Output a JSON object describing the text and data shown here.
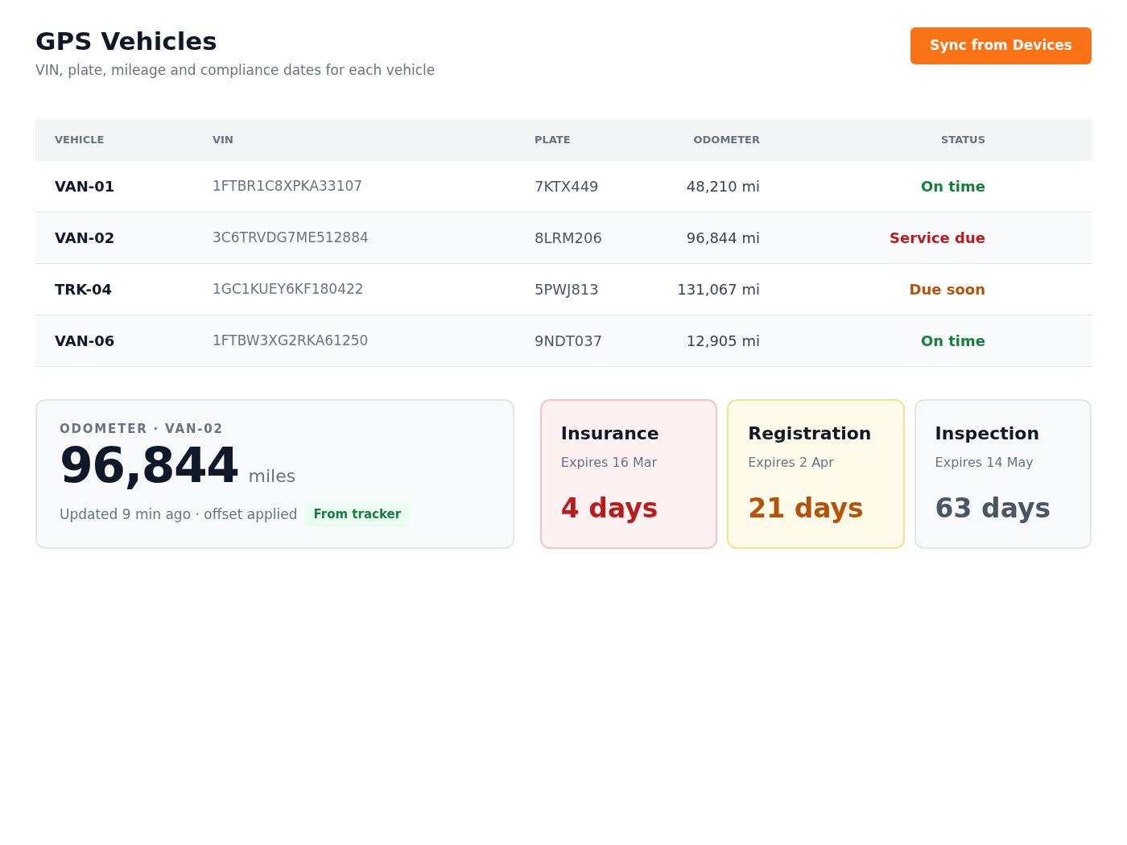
{
  "header": {
    "title": "GPS Vehicles",
    "subtitle": "VIN, plate, mileage and compliance dates for each vehicle",
    "action": "Sync from Devices"
  },
  "table": {
    "columns": [
      "VEHICLE",
      "VIN",
      "PLATE",
      "ODOMETER",
      "STATUS"
    ],
    "rows": [
      {
        "vehicle": "VAN-01",
        "vin": "1FTBR1C8XPKA33107",
        "plate": "7KTX449",
        "odometer": "48,210 mi",
        "status": "On time",
        "kind": "ok"
      },
      {
        "vehicle": "VAN-02",
        "vin": "3C6TRVDG7ME512884",
        "plate": "8LRM206",
        "odometer": "96,844 mi",
        "status": "Service due",
        "kind": "due"
      },
      {
        "vehicle": "TRK-04",
        "vin": "1GC1KUEY6KF180422",
        "plate": "5PWJ813",
        "odometer": "131,067 mi",
        "status": "Due soon",
        "kind": "soon"
      },
      {
        "vehicle": "VAN-06",
        "vin": "1FTBW3XG2RKA61250",
        "plate": "9NDT037",
        "odometer": "12,905 mi",
        "status": "On time",
        "kind": "ok"
      }
    ]
  },
  "odometer_card": {
    "label": "ODOMETER · VAN-02",
    "value": "96,844",
    "unit": "miles",
    "note": "Updated 9 min ago · offset applied",
    "badge": "From tracker"
  },
  "compliance": [
    {
      "title": "Insurance",
      "expires": "Expires 16 Mar",
      "days": "4 days",
      "kind": "urgent"
    },
    {
      "title": "Registration",
      "expires": "Expires 2 Apr",
      "days": "21 days",
      "kind": "warning"
    },
    {
      "title": "Inspection",
      "expires": "Expires 14 May",
      "days": "63 days",
      "kind": "normal"
    }
  ]
}
